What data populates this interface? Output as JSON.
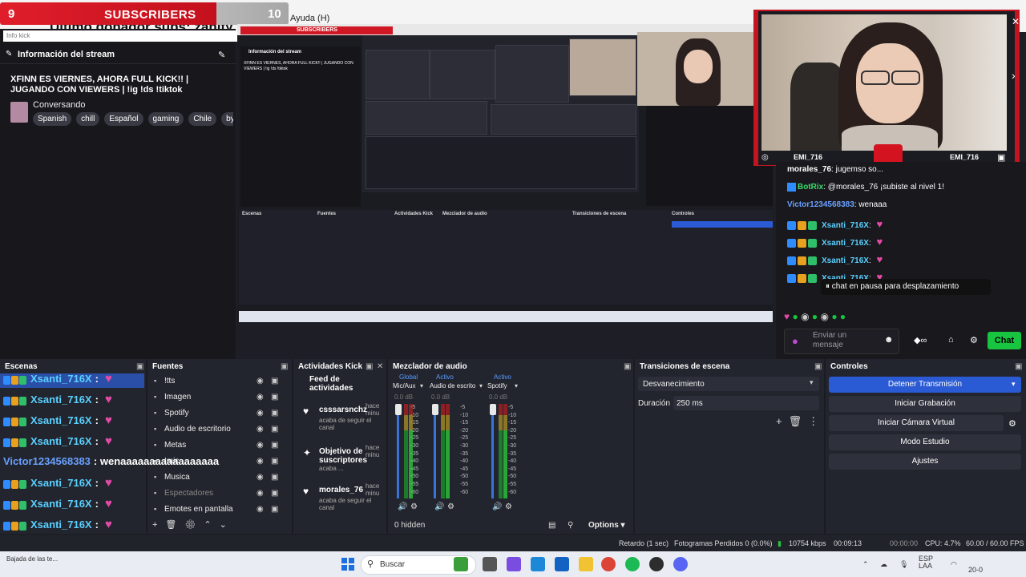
{
  "subscriber_goal": {
    "current": "9",
    "label": "SUBSCRIBERS",
    "goal": "10"
  },
  "donor_ticker": "Ultimo donador subs: zanity",
  "menu_help": "Ayuda (H)",
  "info_search_placeholder": "Info kick",
  "stream_info": {
    "header": "Información del stream",
    "title": "XFINN ES VIERNES, AHORA FULL KICK!! | JUGANDO CON VIEWERS | !ig !ds !tiktok",
    "category": "Conversando",
    "tags": [
      "Spanish",
      "chill",
      "Español",
      "gaming",
      "Chile",
      "byk"
    ]
  },
  "capture": {
    "sub_label": "SUBSCRIBERS",
    "info_header": "Información del stream"
  },
  "webcam": {
    "name_left": "EMI_716",
    "name_right": "EMI_716"
  },
  "chat": {
    "lines": [
      {
        "user": "morales_76",
        "text": ": jugemso so...",
        "color": "#ffffff"
      },
      {
        "user": "BotRix",
        "text": ": @morales_76 ¡subiste al nivel 1!",
        "color": "#3dd96b"
      },
      {
        "user": "Victor1234568383",
        "text": ": wenaaa",
        "color": "#6aa0ff"
      },
      {
        "user": "Xsanti_716X",
        "text": ": ",
        "color": "#5ad0ff"
      },
      {
        "user": "Xsanti_716X",
        "text": ": ",
        "color": "#5ad0ff"
      },
      {
        "user": "Xsanti_716X",
        "text": ": ",
        "color": "#5ad0ff"
      },
      {
        "user": "Xsanti_716X",
        "text": ": ",
        "color": "#5ad0ff"
      }
    ],
    "pause_banner": "chat en pausa para desplazamiento",
    "input_placeholder": "Enviar un mensaje",
    "send_button": "Chat"
  },
  "overlay_chat": {
    "lines": [
      {
        "user": "Xsanti_716X",
        "text": ":"
      },
      {
        "user": "Xsanti_716X",
        "text": ":"
      },
      {
        "user": "Xsanti_716X",
        "text": ":"
      },
      {
        "user": "Xsanti_716X",
        "text": ":"
      },
      {
        "user": "Victor1234568383",
        "text": ": wenaaaaaaaaaaaaaaaaa"
      },
      {
        "user": "Xsanti_716X",
        "text": ":"
      },
      {
        "user": "Xsanti_716X",
        "text": ":"
      },
      {
        "user": "Xsanti_716X",
        "text": ":"
      },
      {
        "user": "Xsanti_716X",
        "text": ":"
      },
      {
        "user": "Xsanti_716X",
        "text": ":"
      }
    ]
  },
  "docks": {
    "scenes": {
      "title": "Escenas"
    },
    "sources": {
      "title": "Fuentes",
      "items": [
        "!tts",
        "Imagen",
        "Spotify",
        "Audio de escritorio",
        "Metas",
        "!mic",
        "Musica",
        "Espectadores",
        "Emotes en pantalla"
      ]
    },
    "activity": {
      "title": "Actividades Kick",
      "feed_label": "Feed de actividades",
      "items": [
        {
          "name": "csssarsnchz",
          "desc": "acaba de seguir el canal",
          "time": "hace minu"
        },
        {
          "name": "Objetivo de suscriptores",
          "desc": "acaba ...",
          "time": "hace minu"
        },
        {
          "name": "morales_76",
          "desc": "acaba de seguir el canal",
          "time": "hace minu"
        }
      ]
    },
    "mixer": {
      "title": "Mezclador de audio",
      "channels": [
        {
          "name": "Mic/Aux",
          "badge": "Global",
          "db": "0.0 dB"
        },
        {
          "name": "Audio de escrito",
          "badge": "Activo",
          "db": "0.0 dB"
        },
        {
          "name": "Spotify",
          "badge": "Activo",
          "db": "0.0 dB"
        }
      ],
      "scale": [
        "-5",
        "-10",
        "-15",
        "-20",
        "-25",
        "-30",
        "-35",
        "-40",
        "-45",
        "-50",
        "-55",
        "-60"
      ],
      "hidden_label": "0 hidden",
      "options_label": "Options"
    },
    "transitions": {
      "title": "Transiciones de escena",
      "selected": "Desvanecimiento",
      "duration_label": "Duración",
      "duration_value": "250 ms"
    },
    "controls": {
      "title": "Controles",
      "buttons": [
        "Detener Transmisión",
        "Iniciar Grabación",
        "Iniciar Cámara Virtual",
        "Modo Estudio",
        "Ajustes"
      ]
    }
  },
  "status": {
    "delay": "Retardo (1 sec)",
    "frames_lost": "Fotogramas Perdidos 0 (0.0%)",
    "bitrate": "10754 kbps",
    "live_time": "00:09:13",
    "rec_time": "00:00:00",
    "cpu": "CPU: 4.7%",
    "fps": "60.00 / 60.00 FPS"
  },
  "taskbar": {
    "search_label": "Buscar",
    "lang": "ESP",
    "lang2": "LAA",
    "date": "20-0",
    "notification": "Bajada de las te..."
  },
  "colors": {
    "kick_green": "#17c540",
    "obs_accent": "#2a5bd4",
    "goal_red": "#e01e2b"
  }
}
